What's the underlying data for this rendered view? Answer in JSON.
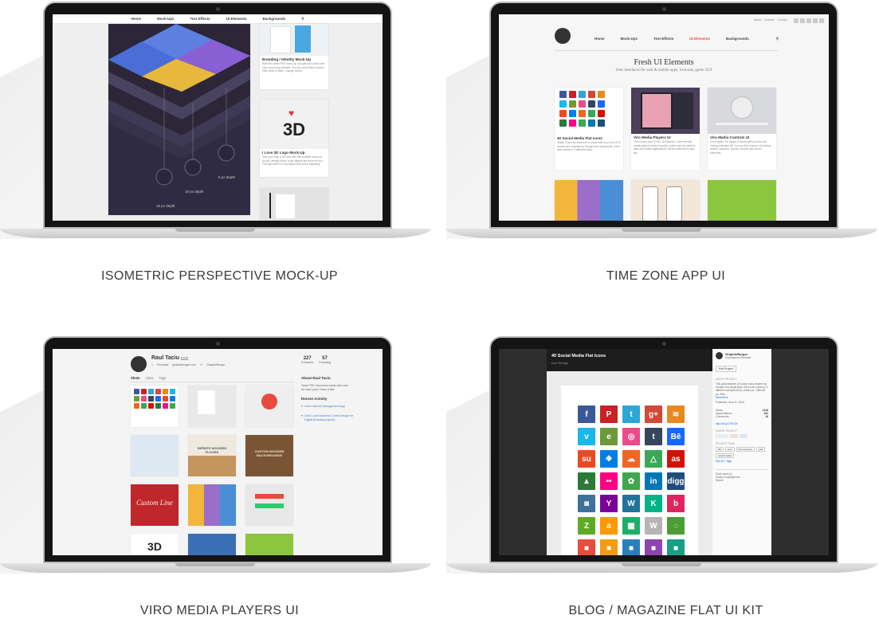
{
  "captions": {
    "c1": "ISOMETRIC PERSPECTIVE MOCK-UP",
    "c2": "TIME ZONE APP UI",
    "c3": "VIRO MEDIA PLAYERS UI",
    "c4": "BLOG / MAGAZINE FLAT UI KIT"
  },
  "screen1": {
    "nav": [
      "Home",
      "Mock-Ups",
      "Text Effects",
      "UI Elements",
      "Backgrounds"
    ],
    "depth15": "15 px depth",
    "depth10": "10 px depth",
    "depth5": "5 px depth",
    "card1_title": "Branding / Identity Mock-Up",
    "card1_text": "With this clean PSD mock-up, you get full control over each and every element. You can move them around, hide some of them, change colors.",
    "card2_title": "I Love 3D Logo Mock-Up",
    "card2_text": "Give your logo a 3D look with this realistic mock-up. As you already know, most objects are there for you. The light effect on top might need some adjusting.",
    "logo3d_text": "3D"
  },
  "screen2": {
    "toplinks": [
      "About",
      "License",
      "Contact"
    ],
    "nav": [
      "Home",
      "Mock-Ups",
      "Text Effects",
      "UI Elements",
      "Backgrounds"
    ],
    "heading": "Fresh UI Elements",
    "sub": "User interfaces for web & mobile apps, icon sets, game GUI",
    "cards": [
      {
        "title": "40 Social Media Flat Icons",
        "text": "Today I have the pleasure to share with you a set of 40 social icons inspired by Google new visual style. Each icon comes in 4 different sizes."
      },
      {
        "title": "Viro Media Players UI",
        "text": "The second part of Viro UI features 2 user-friendly media players (video & audio), which can be used for web and mobile applications. All the elements in this set..."
      },
      {
        "title": "Viro Media Controls UI",
        "text": "Once again, I'm happy to share with you this soft looking interface kit! You can find a bunch of buttons, sliders, switches, checks, all built with vector elements."
      }
    ]
  },
  "screen3": {
    "name": "Raul Taciu",
    "badge": "PRO",
    "location": "Romania",
    "email": "graphicburger.com",
    "twitter": "GraphicBurger",
    "tabs": [
      "Shots",
      "Likes",
      "Tags"
    ],
    "stat1_num": "227",
    "stat1_lbl": "Followers",
    "stat2_num": "57",
    "stat2_lbl": "Following",
    "about_title": "About Raul Taciu",
    "about_text": "Tasty PSD resources made with care for each pixel. Have a bite.",
    "recent_title": "Recent Activity",
    "recent1": "Liked Internal Management App",
    "recent2": "Liked Luxe Business Cards Design for Digital Branding Agency",
    "tile_titles": [
      "INFINITE WOODEN FLOORS",
      "CUSTOM WOODEN BACKGROUNDS",
      "Custom Line",
      "3D"
    ]
  },
  "screen4": {
    "title": "40 Social Media Flat Icons",
    "subtitle": "Icon Design",
    "author": "GraphicBurger",
    "author_loc": "Cluj-Napoca, Romania",
    "edit_btn": "Edit Project",
    "about_lbl": "ABOUT PROJECT",
    "about_text": "This pack features 40 social icons inspired by Google new visual style. Each icon comes in 4 different sizes(32x32 px, 64x64 px, 128x128 px, 256x...",
    "read_more": "Read More",
    "published": "Published: June 11, 2013",
    "views_lbl": "Views",
    "views": "1116",
    "apprec_lbl": "Appreciations",
    "apprec": "202",
    "comments_lbl": "Comments",
    "comments": "16",
    "link": "http://bit.ly/17EnZ2t",
    "share_lbl": "SHARE PROJECT",
    "tags_lbl": "PROJECT TAGS",
    "tags": [
      "flat",
      "icon",
      "free resource",
      "psd",
      "social media"
    ],
    "see_all": "See all 7 Tags",
    "footer": [
      "Tools Used (1)",
      "Project Copyright Info",
      "Report"
    ],
    "icons": [
      {
        "c": "#3b5998",
        "g": "f"
      },
      {
        "c": "#cb2027",
        "g": "P"
      },
      {
        "c": "#2fa5d8",
        "g": "t"
      },
      {
        "c": "#d34836",
        "g": "g+"
      },
      {
        "c": "#e8891f",
        "g": "≋"
      },
      {
        "c": "#1ab7ea",
        "g": "v"
      },
      {
        "c": "#6c9a3a",
        "g": "e"
      },
      {
        "c": "#ea4c89",
        "g": "◎"
      },
      {
        "c": "#35465c",
        "g": "t"
      },
      {
        "c": "#1769ff",
        "g": "Bē"
      },
      {
        "c": "#eb4924",
        "g": "su"
      },
      {
        "c": "#007ee5",
        "g": "❖"
      },
      {
        "c": "#f26522",
        "g": "☁"
      },
      {
        "c": "#3aa757",
        "g": "△"
      },
      {
        "c": "#d51007",
        "g": "as"
      },
      {
        "c": "#2c7a38",
        "g": "▲"
      },
      {
        "c": "#ff0084",
        "g": "••"
      },
      {
        "c": "#3fa74c",
        "g": "✿"
      },
      {
        "c": "#0077b5",
        "g": "in"
      },
      {
        "c": "#1f4d7a",
        "g": "digg"
      },
      {
        "c": "#3f729b",
        "g": "◙"
      },
      {
        "c": "#7b0099",
        "g": "Y"
      },
      {
        "c": "#21759b",
        "g": "W"
      },
      {
        "c": "#00b489",
        "g": "K"
      },
      {
        "c": "#e0245e",
        "g": "b"
      },
      {
        "c": "#5eaa27",
        "g": "Z"
      },
      {
        "c": "#ff9900",
        "g": "a"
      },
      {
        "c": "#1daf6a",
        "g": "▦"
      },
      {
        "c": "#b5b5b5",
        "g": "W"
      },
      {
        "c": "#4c9d31",
        "g": "◌"
      },
      {
        "c": "#e74c3c",
        "g": "■"
      },
      {
        "c": "#f39c12",
        "g": "■"
      },
      {
        "c": "#2980b9",
        "g": "■"
      },
      {
        "c": "#8e44ad",
        "g": "■"
      },
      {
        "c": "#16a085",
        "g": "■"
      }
    ]
  }
}
